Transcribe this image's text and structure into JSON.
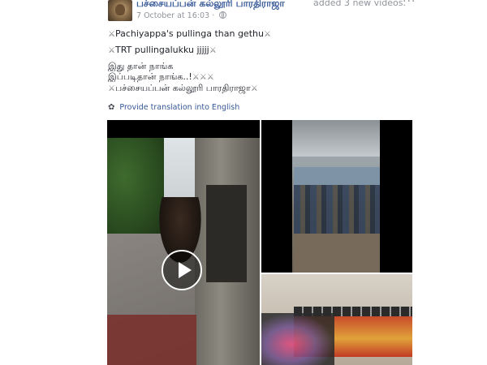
{
  "post": {
    "author": "பச்சையப்பன் கல்லூரி பாரதிராஜா",
    "action": "added 3 new videos.",
    "timestamp": "7 October at 16:03",
    "options_glyph": "···",
    "lines": [
      {
        "pre": "⚔",
        "text": "Pachiyappa's pullinga than gethu",
        "post": "⚔"
      },
      {
        "pre": "⚔",
        "text": "TRT pullingalukku jjjjj",
        "post": "⚔"
      },
      {
        "pre": "",
        "text": "இது தான் நாங்க",
        "post": ""
      },
      {
        "pre": "",
        "text": "இப்படிதான் நாங்க..!",
        "post": "⚔⚔⚔"
      },
      {
        "pre": "⚔",
        "text": "பச்சையப்பன் கல்லூரி பாரதிராஜா",
        "post": "⚔"
      }
    ],
    "translate_label": "Provide translation into English"
  },
  "colors": {
    "link": "#365899",
    "meta": "#90949c",
    "text": "#1d2129"
  },
  "icons": {
    "globe": "globe-icon",
    "gear": "gear-icon",
    "play": "play-icon"
  }
}
